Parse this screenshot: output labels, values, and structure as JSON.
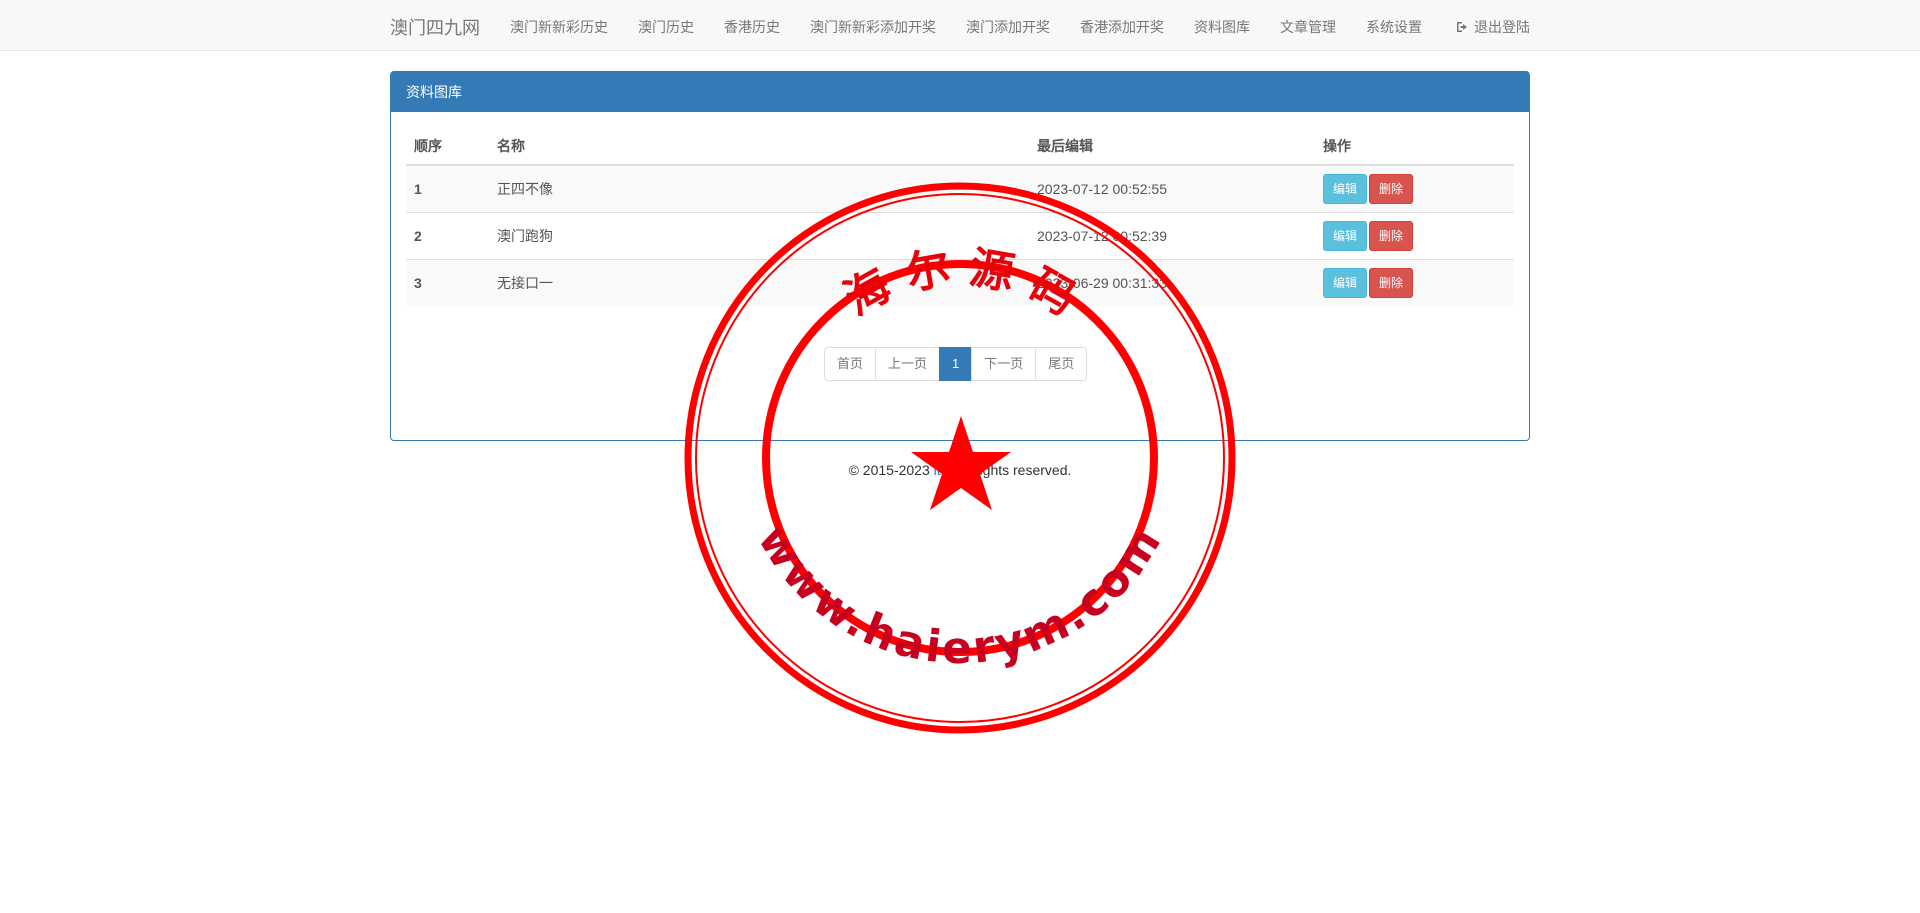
{
  "navbar": {
    "brand": "澳门四九网",
    "items": [
      "澳门新新彩历史",
      "澳门历史",
      "香港历史",
      "澳门新新彩添加开奖",
      "澳门添加开奖",
      "香港添加开奖",
      "资料图库",
      "文章管理",
      "系统设置"
    ],
    "logout": "退出登陆"
  },
  "panel": {
    "title": "资料图库",
    "headers": [
      "顺序",
      "名称",
      "最后编辑",
      "操作"
    ],
    "rows": [
      {
        "order": "1",
        "name": "正四不像",
        "edited": "2023-07-12 00:52:55"
      },
      {
        "order": "2",
        "name": "澳门跑狗",
        "edited": "2023-07-12 00:52:39"
      },
      {
        "order": "3",
        "name": "无接口一",
        "edited": "2023-06-29 00:31:33"
      }
    ],
    "edit_label": "编辑",
    "delete_label": "删除"
  },
  "pagination": {
    "first": "首页",
    "prev": "上一页",
    "current": "1",
    "next": "下一页",
    "last": "尾页"
  },
  "footer": {
    "prefix": "© 2015-2023 ",
    "link": "itta",
    "suffix": " All rights reserved."
  },
  "watermark": {
    "top_text": "海 尔 源 码",
    "bottom_text": "www.haierym.com",
    "color": "#e8000b"
  }
}
